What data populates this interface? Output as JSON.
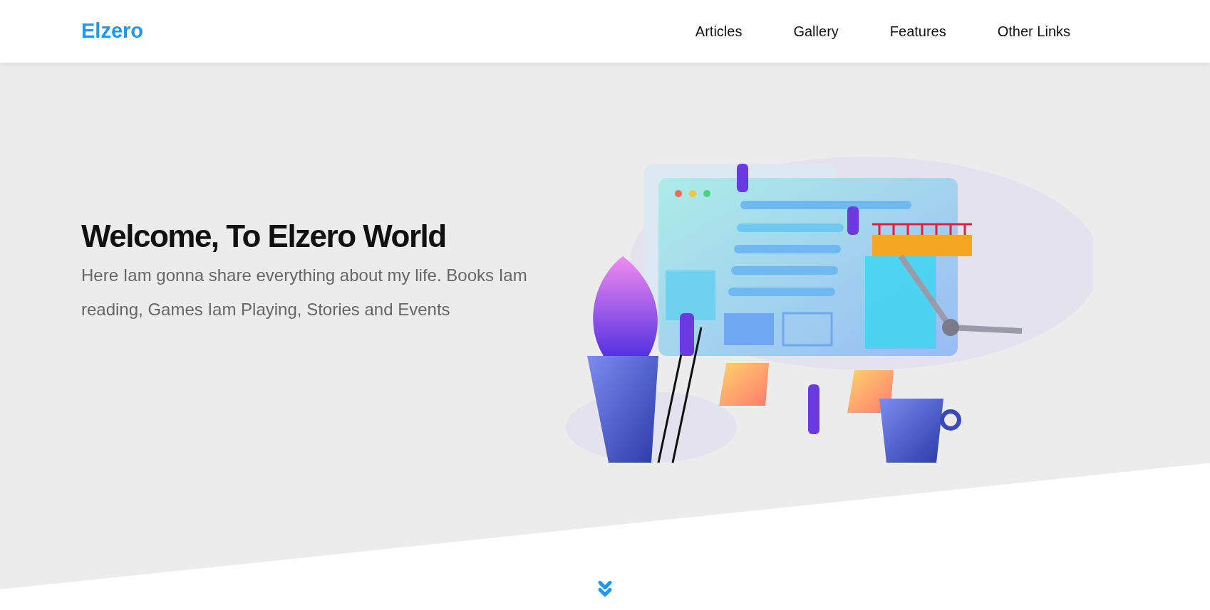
{
  "header": {
    "logo": "Elzero",
    "nav": [
      "Articles",
      "Gallery",
      "Features",
      "Other Links"
    ]
  },
  "hero": {
    "title": "Welcome, To Elzero World",
    "description": "Here Iam gonna share everything about my life. Books Iam reading, Games Iam Playing, Stories and Events"
  }
}
